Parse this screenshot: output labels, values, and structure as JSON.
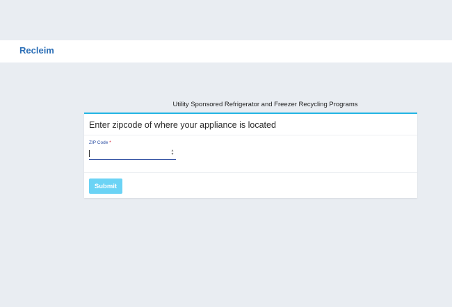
{
  "header": {
    "brand": "Recleim"
  },
  "page": {
    "program_title": "Utility Sponsored Refrigerator and Freezer Recycling Programs"
  },
  "card": {
    "heading": "Enter zipcode of where your appliance is located",
    "zip_field": {
      "label": "ZIP Code",
      "required_marker": "*",
      "value": ""
    },
    "submit_label": "Submit"
  },
  "colors": {
    "brand": "#2c6fb7",
    "card_accent": "#22b5e4",
    "field_underline": "#2f4ea1",
    "submit_bg": "#6bd3f5",
    "page_bg": "#e9edf2"
  },
  "icons": {
    "spinner": "number-spinner-icon"
  }
}
